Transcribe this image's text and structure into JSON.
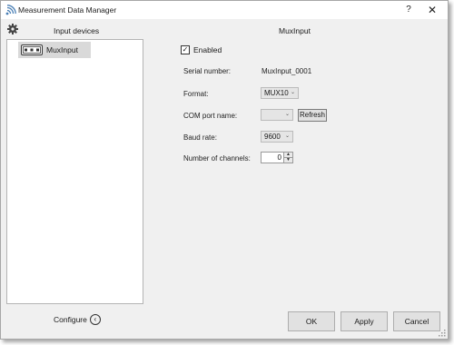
{
  "window": {
    "title": "Measurement Data Manager",
    "help": "?",
    "close": "✕"
  },
  "left_panel": {
    "title": "Input devices",
    "devices": [
      {
        "label": "MuxInput",
        "selected": true
      }
    ],
    "configure_label": "Configure",
    "configure_glyph": "‹"
  },
  "right_panel": {
    "title": "MuxInput",
    "enabled_label": "Enabled",
    "enabled_checked": true,
    "check_glyph": "✓",
    "serial_label": "Serial number:",
    "serial_value": "MuxInput_0001",
    "format_label": "Format:",
    "format_value": "MUX10",
    "com_label": "COM port name:",
    "com_value": "",
    "refresh_label": "Refresh",
    "baud_label": "Baud rate:",
    "baud_value": "9600",
    "channels_label": "Number of channels:",
    "channels_value": "0",
    "chevron": "⌄"
  },
  "footer": {
    "ok": "OK",
    "apply": "Apply",
    "cancel": "Cancel"
  },
  "colors": {
    "selection": "#d9d9d9",
    "background": "#f0f0f0",
    "button": "#e1e1e1"
  }
}
